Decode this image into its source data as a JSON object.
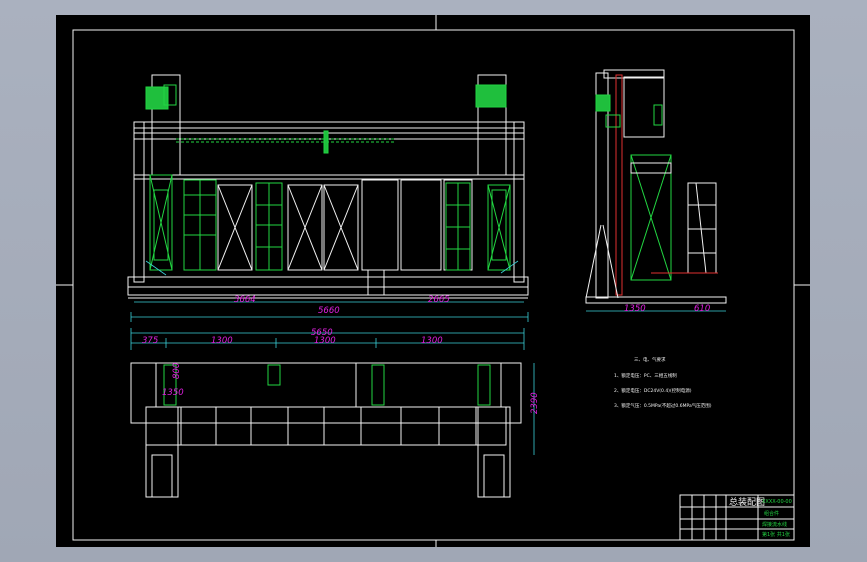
{
  "drawing": {
    "dims_front": [
      "3664",
      "5660",
      "2665"
    ],
    "dims_top": [
      "5650",
      "375",
      "1300",
      "1300",
      "1300",
      "2390"
    ],
    "dims_side": [
      "1350",
      "610"
    ],
    "small_marks": [
      "800",
      "1350"
    ],
    "notes_heading": "三、电、气要求",
    "notes": [
      "1、额定电压：PC、三相五线制",
      "2、额定电压：DC24V(0.4)(控制电源)",
      "3、额定气压：0.5MPa(不超过0.6MPa气压范围)"
    ],
    "title_block": {
      "name": "总装配图",
      "code": "XXXX-00-00",
      "material": "组合件",
      "company": "焊接流水线",
      "extra": "第1张 共1张"
    }
  }
}
